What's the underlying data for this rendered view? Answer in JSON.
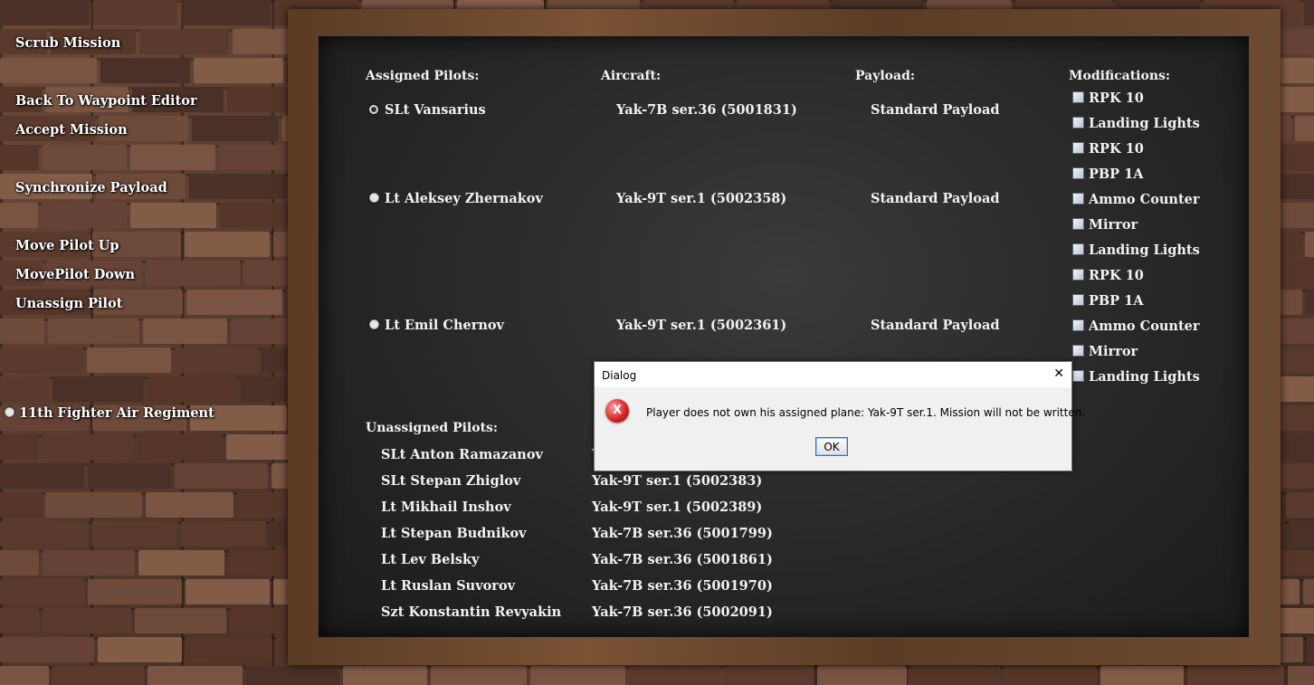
{
  "menu": {
    "scrub_mission": "Scrub Mission",
    "back_to_waypoint": "Back To Waypoint Editor",
    "accept_mission": "Accept Mission",
    "sync_payload": "Synchronize Payload",
    "move_up": "Move Pilot Up",
    "move_down": "MovePilot Down",
    "unassign": "Unassign Pilot",
    "regiment": "11th Fighter Air Regiment"
  },
  "headers": {
    "assigned": "Assigned Pilots:",
    "aircraft": "Aircraft:",
    "payload": "Payload:",
    "mods": "Modifications:",
    "unassigned": "Unassigned Pilots:"
  },
  "assigned": [
    {
      "pilot": "SLt Vansarius",
      "aircraft": "Yak-7B ser.36 (5001831)",
      "payload": "Standard Payload"
    },
    {
      "pilot": "Lt Aleksey Zhernakov",
      "aircraft": "Yak-9T ser.1 (5002358)",
      "payload": "Standard Payload"
    },
    {
      "pilot": "Lt Emil Chernov",
      "aircraft": "Yak-9T ser.1 (5002361)",
      "payload": "Standard Payload"
    }
  ],
  "modifications": [
    "RPK 10",
    "Landing Lights",
    "RPK 10",
    "PBP 1A",
    "Ammo Counter",
    "Mirror",
    "Landing Lights",
    "RPK 10",
    "PBP 1A",
    "Ammo Counter",
    "Mirror",
    "Landing Lights"
  ],
  "unassigned": [
    {
      "pilot": "SLt Anton Ramazanov",
      "aircraft": "Y"
    },
    {
      "pilot": "SLt Stepan Zhiglov",
      "aircraft": "Yak-9T ser.1 (5002383)"
    },
    {
      "pilot": "Lt Mikhail Inshov",
      "aircraft": "Yak-9T ser.1 (5002389)"
    },
    {
      "pilot": "Lt Stepan Budnikov",
      "aircraft": "Yak-7B ser.36 (5001799)"
    },
    {
      "pilot": "Lt Lev Belsky",
      "aircraft": "Yak-7B ser.36 (5001861)"
    },
    {
      "pilot": "Lt Ruslan Suvorov",
      "aircraft": "Yak-7B ser.36 (5001970)"
    },
    {
      "pilot": "Szt Konstantin Revyakin",
      "aircraft": "Yak-7B ser.36 (5002091)"
    }
  ],
  "dialog": {
    "title": "Dialog",
    "close": "✕",
    "icon": "X",
    "message": "Player does not own his assigned plane: Yak-9T ser.1.  Mission will not be written.",
    "ok": "OK"
  }
}
